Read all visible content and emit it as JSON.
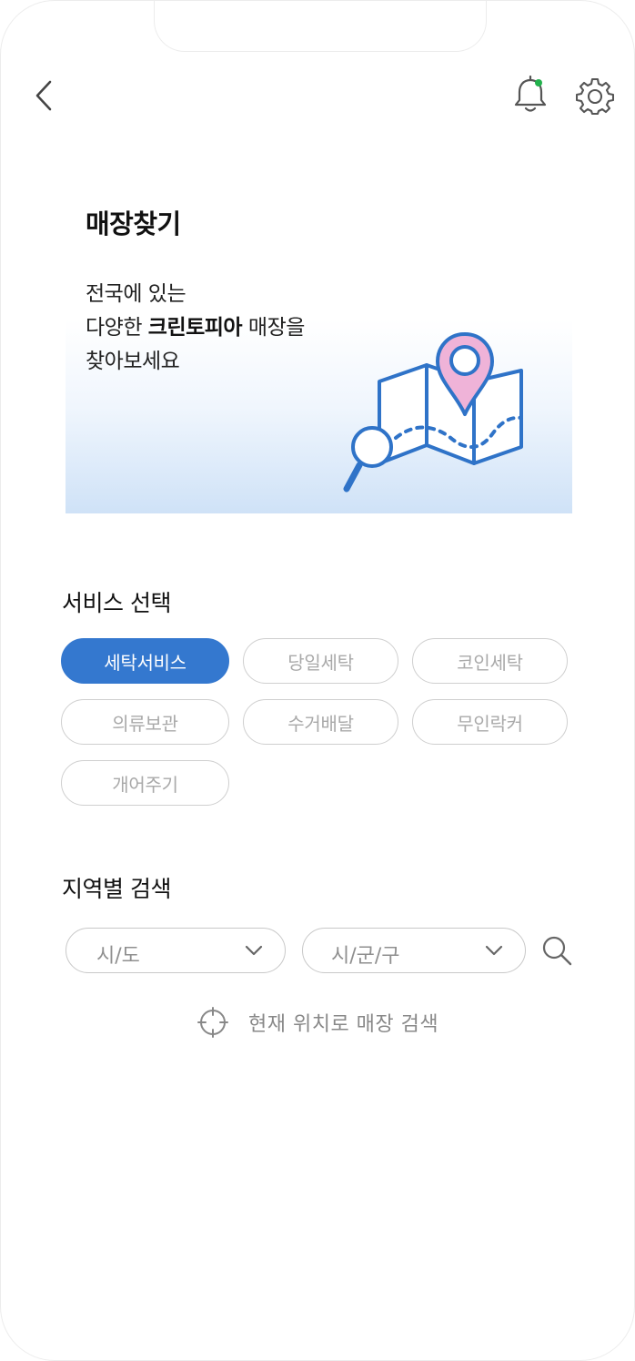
{
  "header": {
    "back_icon": "chevron-left-icon",
    "bell_icon": "bell-icon",
    "bell_dot_color": "#22b14c",
    "settings_icon": "gear-icon"
  },
  "page": {
    "title": "매장찾기"
  },
  "banner": {
    "line1": "전국에 있는",
    "line2_prefix": "다양한 ",
    "line2_brand": "크린토피아",
    "line2_suffix": " 매장을",
    "line3": "찾아보세요",
    "illustration_icon": "map-pin-magnifier-icon"
  },
  "services": {
    "title": "서비스 선택",
    "options": [
      {
        "label": "세탁서비스",
        "selected": true
      },
      {
        "label": "당일세탁",
        "selected": false
      },
      {
        "label": "코인세탁",
        "selected": false
      },
      {
        "label": "의류보관",
        "selected": false
      },
      {
        "label": "수거배달",
        "selected": false
      },
      {
        "label": "무인락커",
        "selected": false
      },
      {
        "label": "개어주기",
        "selected": false
      }
    ]
  },
  "region": {
    "title": "지역별 검색",
    "province_select": {
      "value": "시/도"
    },
    "district_select": {
      "value": "시/군/구"
    },
    "search_icon": "search-icon",
    "locate_icon": "crosshair-icon",
    "current_location_label": "현재 위치로 매장 검색"
  },
  "colors": {
    "accent": "#3478cf",
    "pin": "#efb3d8",
    "map_line": "#2f73c8"
  }
}
